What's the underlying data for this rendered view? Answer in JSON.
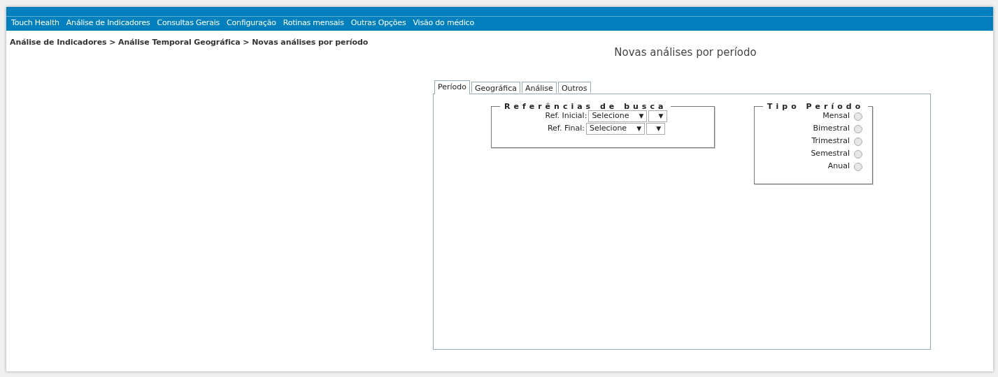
{
  "menu": [
    "Touch Health",
    "Análise de Indicadores",
    "Consultas Gerais",
    "Configuração",
    "Rotinas mensais",
    "Outras Opções",
    "Visão do médico"
  ],
  "breadcrumb": "Análise de Indicadores > Análise Temporal Geográfica > Novas análises por período",
  "title": "Novas análises por período",
  "tabs": [
    {
      "label": "Período",
      "selected": true
    },
    {
      "label": "Geográfica",
      "selected": false
    },
    {
      "label": "Análise",
      "selected": false
    },
    {
      "label": "Outros",
      "selected": false
    }
  ],
  "search_refs": {
    "legend": "Referências de busca",
    "rows": [
      {
        "label": "Ref. Inicial:",
        "value": "Selecione",
        "caret": "▼",
        "caret_2": "▼"
      },
      {
        "label": "Ref. Final:",
        "value": "Selecione",
        "caret": "▼",
        "caret_2": "▼"
      }
    ]
  },
  "period_type": {
    "legend": "Tipo Período",
    "options": [
      {
        "label": "Mensal",
        "selected": false
      },
      {
        "label": "Bimestral",
        "selected": false
      },
      {
        "label": "Trimestral",
        "selected": false
      },
      {
        "label": "Semestral",
        "selected": false
      },
      {
        "label": "Anual",
        "selected": false
      }
    ]
  }
}
